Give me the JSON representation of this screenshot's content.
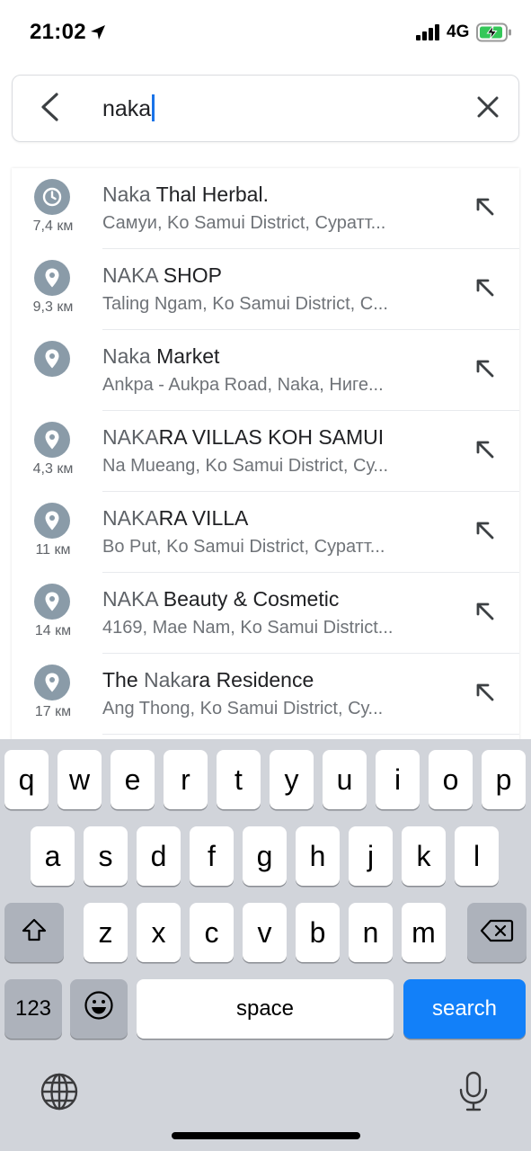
{
  "status_bar": {
    "time": "21:02",
    "network": "4G",
    "battery_charging": true,
    "accent_battery": "#34c759"
  },
  "search": {
    "query": "naka",
    "back_icon": "chevron-left-icon",
    "clear_icon": "close-icon"
  },
  "results": [
    {
      "icon": "clock-icon",
      "distance": "7,4 км",
      "title_match": "Naka",
      "title_rest": " Thal Herbal.",
      "subtitle": "Самуи, Ko Samui District, Суратт..."
    },
    {
      "icon": "location-pin-icon",
      "distance": "9,3 км",
      "title_match": "NAKA",
      "title_rest": " SHOP",
      "subtitle": "Taling Ngam, Ko Samui District, C..."
    },
    {
      "icon": "location-pin-icon",
      "distance": "",
      "title_match": "Naka",
      "title_rest": " Market",
      "subtitle": "Ankpa - Aukpa Road, Naka, Ниге..."
    },
    {
      "icon": "location-pin-icon",
      "distance": "4,3 км",
      "title_match": "NAKA",
      "title_rest": "RA VILLAS KOH SAMUI",
      "subtitle": "Na Mueang, Ko Samui District, Су..."
    },
    {
      "icon": "location-pin-icon",
      "distance": "11 км",
      "title_match": "NAKA",
      "title_rest": "RA VILLA",
      "subtitle": "Bo Put, Ko Samui District, Суратт..."
    },
    {
      "icon": "location-pin-icon",
      "distance": "14 км",
      "title_match": "NAKA",
      "title_rest": " Beauty & Cosmetic",
      "subtitle": "4169, Mae Nam, Ko Samui District..."
    },
    {
      "icon": "location-pin-icon",
      "distance": "17 км",
      "title_pre": "The ",
      "title_match": "Naka",
      "title_rest": "ra Residence",
      "subtitle": "Ang Thong, Ko Samui District, Су..."
    },
    {
      "icon": "location-pin-icon",
      "distance": "",
      "title_match": "",
      "title_rest": "",
      "subtitle": ""
    }
  ],
  "keyboard": {
    "row1": [
      "q",
      "w",
      "e",
      "r",
      "t",
      "y",
      "u",
      "i",
      "o",
      "p"
    ],
    "row2": [
      "a",
      "s",
      "d",
      "f",
      "g",
      "h",
      "j",
      "k",
      "l"
    ],
    "row3": [
      "z",
      "x",
      "c",
      "v",
      "b",
      "n",
      "m"
    ],
    "numbers_key": "123",
    "space_key": "space",
    "search_key": "search",
    "search_key_color": "#1280f9"
  }
}
